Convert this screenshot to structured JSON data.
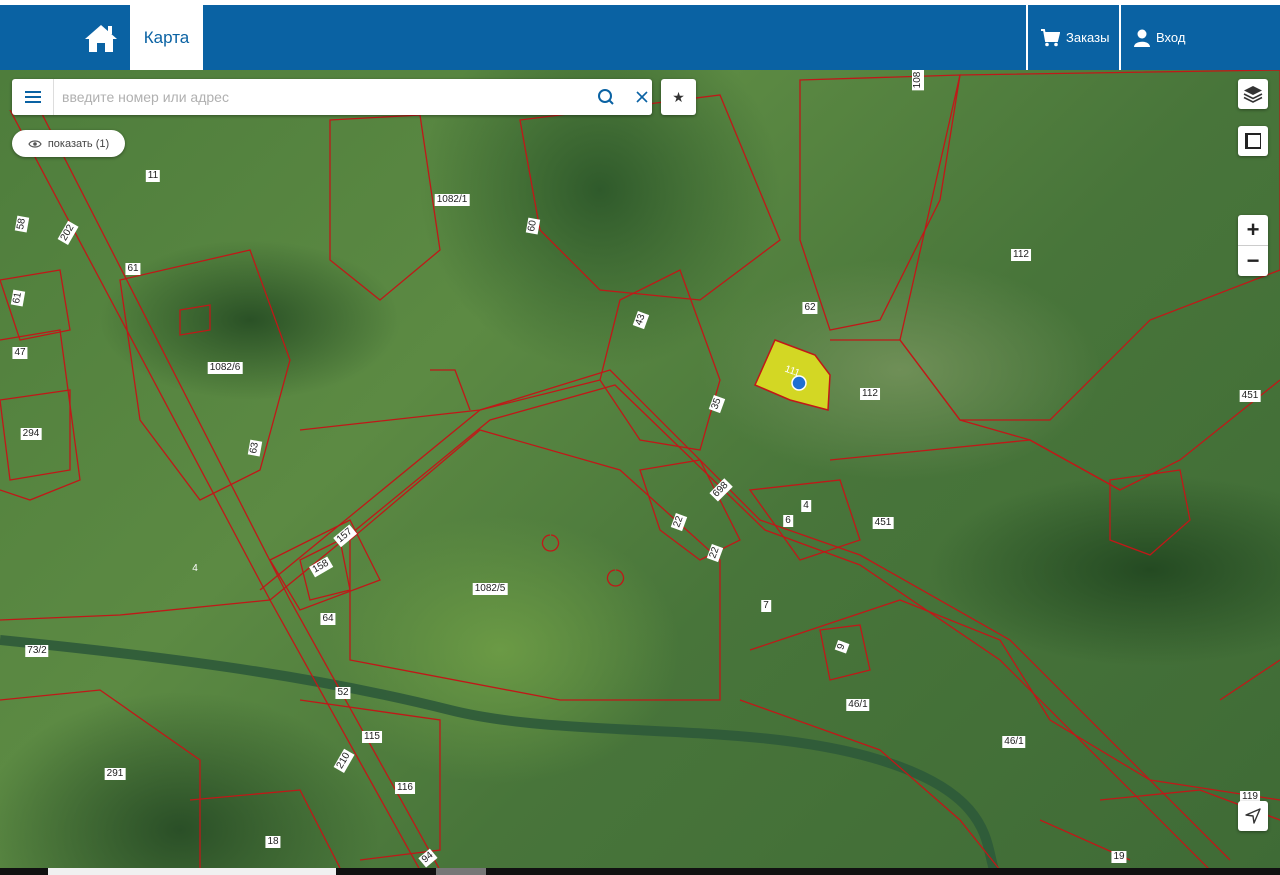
{
  "header": {
    "home_icon": "home-icon",
    "tab_map": "Карта",
    "orders_label": "Заказы",
    "orders_icon": "cart-icon",
    "login_label": "Вход",
    "login_icon": "user-icon",
    "colors": {
      "bar": "#0a62a3",
      "tab_bg": "#ffffff"
    }
  },
  "search": {
    "placeholder": "введите номер или адрес",
    "value": "",
    "menu_icon": "hamburger-icon",
    "search_icon": "search-icon",
    "clear_icon": "close-icon",
    "favorite_icon": "star-icon"
  },
  "show_button": {
    "label": "показать (1)",
    "icon": "eye-icon"
  },
  "map_controls": {
    "layers_icon": "layers-icon",
    "frame_icon": "frame-icon",
    "zoom_in": "+",
    "zoom_out": "−",
    "locate_icon": "navigation-arrow-icon"
  },
  "map": {
    "colors": {
      "parcel_border": "#c01818",
      "selected_fill": "#e0e020",
      "marker": "#1f6fd1"
    },
    "selected_parcel": "114",
    "parcel_labels": [
      "11",
      "1082/1",
      "60",
      "108",
      "58",
      "202",
      "61",
      "61",
      "47",
      "43",
      "62",
      "112",
      "1082/6",
      "111",
      "112",
      "451",
      "35",
      "294",
      "63",
      "698",
      "6",
      "4",
      "451",
      "22",
      "157",
      "22",
      "158",
      "1082/5",
      "4",
      "7",
      "64",
      "73/2",
      "9",
      "52",
      "46/1",
      "210",
      "115",
      "46/1",
      "291",
      "116",
      "18",
      "94",
      "19",
      "119"
    ]
  }
}
